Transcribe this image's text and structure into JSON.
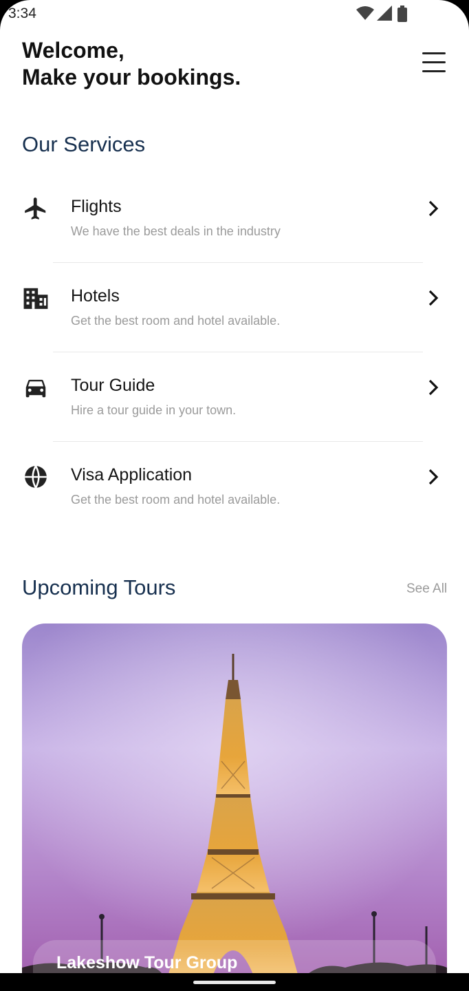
{
  "status_bar": {
    "time": "3:34"
  },
  "header": {
    "greeting_line1": "Welcome,",
    "greeting_line2": "Make your bookings."
  },
  "services": {
    "title": "Our Services",
    "items": [
      {
        "name": "Flights",
        "description": "We have the best deals in the industry",
        "icon": "airplane-icon"
      },
      {
        "name": "Hotels",
        "description": "Get the best room and hotel available.",
        "icon": "hotel-building-icon"
      },
      {
        "name": "Tour Guide",
        "description": "Hire a tour guide in your town.",
        "icon": "car-icon"
      },
      {
        "name": "Visa Application",
        "description": "Get the best room and hotel available.",
        "icon": "globe-icon"
      }
    ]
  },
  "tours": {
    "title": "Upcoming Tours",
    "see_all": "See All",
    "cards": [
      {
        "name": "Lakeshow Tour Group"
      }
    ]
  },
  "colors": {
    "section_title": "#17304f",
    "description_text": "#9a9a9a",
    "sky_top": "#a48ad0",
    "sky_bottom": "#b46fb8"
  }
}
